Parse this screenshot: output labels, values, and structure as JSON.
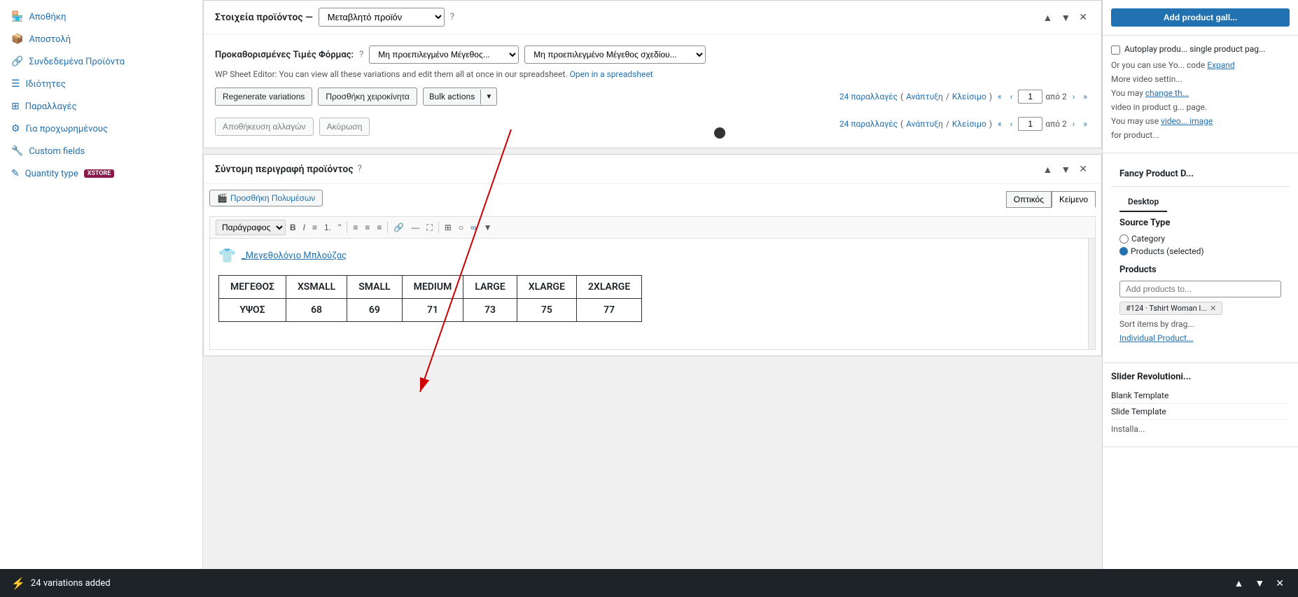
{
  "sidebar": {
    "items": [
      {
        "id": "apoithiki",
        "label": "Αποθήκη",
        "icon": "🏪"
      },
      {
        "id": "apostoli",
        "label": "Αποστολή",
        "icon": "📦"
      },
      {
        "id": "syndedema",
        "label": "Συνδεδεμένα Προϊόντα",
        "icon": "🔗"
      },
      {
        "id": "idiotites",
        "label": "Ιδιότητες",
        "icon": "☰"
      },
      {
        "id": "paralages",
        "label": "Παραλλαγές",
        "icon": "⊞"
      },
      {
        "id": "prox",
        "label": "Για προχωρημένους",
        "icon": "⚙"
      },
      {
        "id": "custom",
        "label": "Custom fields",
        "icon": "🔧"
      },
      {
        "id": "quantity",
        "label": "Quantity type",
        "icon": "✎",
        "badge": "XSTORE"
      }
    ]
  },
  "product_panel": {
    "title": "Στοιχεία προϊόντος —",
    "type_select": "Μεταβλητό προϊόν",
    "form_label": "Προκαθορισμένες Τιμές Φόρμας:",
    "dropdown1": "Μη προεπιλεγμένο Μέγεθος...",
    "dropdown2": "Μη προεπιλεγμένο Μέγεθος σχεδίου...",
    "wp_sheet_text": "WP Sheet Editor: You can view all these variations and edit them all at once in our spreadsheet.",
    "open_spreadsheet": "Open in a spreadsheet",
    "btn_regenerate": "Regenerate variations",
    "btn_add_manual": "Προσθήκη χειροκίνητα",
    "btn_bulk": "Bulk actions",
    "pagination_count": "24 παραλλαγές",
    "pagination_expand": "Ανάπτυξη",
    "pagination_close": "Κλείσιμο",
    "page_num": "1",
    "page_total": "από 2",
    "btn_save": "Αποθήκευση αλλαγών",
    "btn_cancel": "Ακύρωση",
    "pagination_count2": "24 παραλλαγές",
    "page_num2": "1",
    "page_total2": "από 2"
  },
  "desc_panel": {
    "title": "Σύντομη περιγραφή προϊόντος",
    "btn_add_media": "Προσθήκη Πολυμέσων",
    "tab_visual": "Οπτικός",
    "tab_text": "Κείμενο",
    "toolbar": {
      "format_select": "Παράγραφος",
      "bold": "B",
      "italic": "I",
      "unordered": "≡",
      "ordered": "1.",
      "blockquote": "\"",
      "align_left": "≡",
      "align_center": "≡",
      "align_right": "≡",
      "link": "🔗",
      "more": "...",
      "table": "⊞",
      "embed": "○",
      "chain": "∞"
    },
    "content_icon_label": "_Μεγεθολόγιο Μπλούζας",
    "table_headers": [
      "ΜΕΓΕΘΟΣ",
      "XSMALL",
      "SMALL",
      "MEDIUM",
      "LARGE",
      "XLARGE",
      "2XLARGE"
    ],
    "table_row1": [
      "ΥΨΟΣ",
      "68",
      "69",
      "71",
      "73",
      "75",
      "77"
    ]
  },
  "notification": {
    "icon": "⚡",
    "text": "24 variations added"
  },
  "right_sidebar": {
    "add_gallery_btn": "Add product gall...",
    "autoplay_label": "Autoplay produ... single product pag...",
    "or_text": "Or you can use Yo... code",
    "expand_link": "Expand",
    "more_video_title": "More video settin...",
    "change_link": "change th...",
    "video_product_text": "video in product g... page.",
    "video_image_link": "video... image",
    "for_product_text": "for product...",
    "fancy_title": "Fancy Product D...",
    "desktop_tab": "Desktop",
    "source_type_label": "Source Type",
    "category_radio": "Category",
    "products_label": "Products",
    "products_placeholder": "Add products to...",
    "product_tag": "#124 · Tshirt Woman I...",
    "sort_text": "Sort items by drag...",
    "individual_product": "Individual Product...",
    "slider_rev_title": "Slider Revolutioni...",
    "blank_template": "Blank Template",
    "slide_template": "Slide Template",
    "installa_text": "Installa..."
  }
}
